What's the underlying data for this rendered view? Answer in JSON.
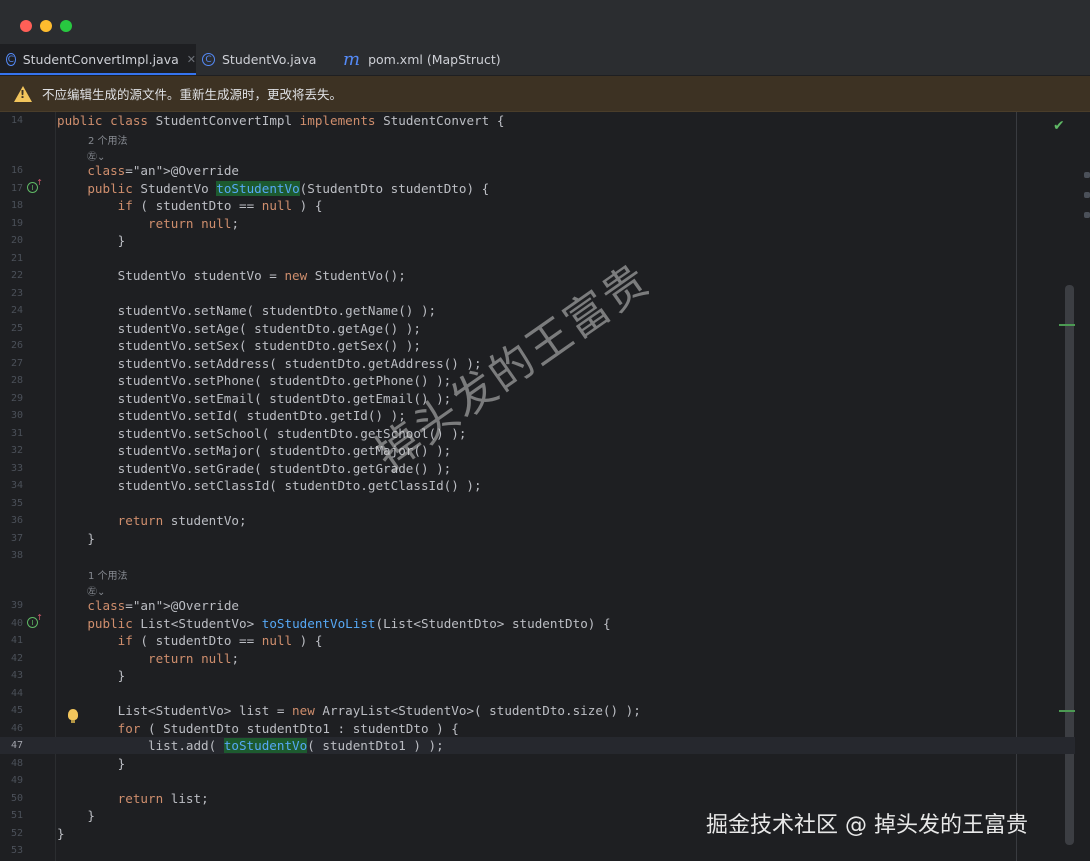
{
  "window": {
    "controls": [
      "close",
      "minimize",
      "maximize"
    ]
  },
  "tabs": [
    {
      "label": "StudentConvertImpl.java",
      "icon": "class-c-icon",
      "active": true,
      "close": "✕"
    },
    {
      "label": "StudentVo.java",
      "icon": "class-c-icon",
      "active": false
    },
    {
      "label": "pom.xml (MapStruct)",
      "icon": "maven-m-icon",
      "active": false
    }
  ],
  "warning": {
    "icon": "warning-triangle-icon",
    "text": "不应编辑生成的源文件。重新生成源时，更改将丢失。"
  },
  "hints": {
    "usages1": "2 个用法",
    "usages2": "1 个用法",
    "author_glyph": "㊧⌄"
  },
  "lines": [
    {
      "n": "14",
      "code": "public class StudentConvertImpl implements StudentConvert {"
    },
    {
      "n": "16",
      "code": "    @Override"
    },
    {
      "n": "17",
      "code": "    public StudentVo toStudentVo(StudentDto studentDto) {"
    },
    {
      "n": "18",
      "code": "        if ( studentDto == null ) {"
    },
    {
      "n": "19",
      "code": "            return null;"
    },
    {
      "n": "20",
      "code": "        }"
    },
    {
      "n": "21",
      "code": ""
    },
    {
      "n": "22",
      "code": "        StudentVo studentVo = new StudentVo();"
    },
    {
      "n": "23",
      "code": ""
    },
    {
      "n": "24",
      "code": "        studentVo.setName( studentDto.getName() );"
    },
    {
      "n": "25",
      "code": "        studentVo.setAge( studentDto.getAge() );"
    },
    {
      "n": "26",
      "code": "        studentVo.setSex( studentDto.getSex() );"
    },
    {
      "n": "27",
      "code": "        studentVo.setAddress( studentDto.getAddress() );"
    },
    {
      "n": "28",
      "code": "        studentVo.setPhone( studentDto.getPhone() );"
    },
    {
      "n": "29",
      "code": "        studentVo.setEmail( studentDto.getEmail() );"
    },
    {
      "n": "30",
      "code": "        studentVo.setId( studentDto.getId() );"
    },
    {
      "n": "31",
      "code": "        studentVo.setSchool( studentDto.getSchool() );"
    },
    {
      "n": "32",
      "code": "        studentVo.setMajor( studentDto.getMajor() );"
    },
    {
      "n": "33",
      "code": "        studentVo.setGrade( studentDto.getGrade() );"
    },
    {
      "n": "34",
      "code": "        studentVo.setClassId( studentDto.getClassId() );"
    },
    {
      "n": "35",
      "code": ""
    },
    {
      "n": "36",
      "code": "        return studentVo;"
    },
    {
      "n": "37",
      "code": "    }"
    },
    {
      "n": "38",
      "code": ""
    },
    {
      "n": "39",
      "code": "    @Override"
    },
    {
      "n": "40",
      "code": "    public List<StudentVo> toStudentVoList(List<StudentDto> studentDto) {"
    },
    {
      "n": "41",
      "code": "        if ( studentDto == null ) {"
    },
    {
      "n": "42",
      "code": "            return null;"
    },
    {
      "n": "43",
      "code": "        }"
    },
    {
      "n": "44",
      "code": ""
    },
    {
      "n": "45",
      "code": "        List<StudentVo> list = new ArrayList<StudentVo>( studentDto.size() );"
    },
    {
      "n": "46",
      "code": "        for ( StudentDto studentDto1 : studentDto ) {"
    },
    {
      "n": "47",
      "code": "            list.add( toStudentVo( studentDto1 ) );"
    },
    {
      "n": "48",
      "code": "        }"
    },
    {
      "n": "49",
      "code": ""
    },
    {
      "n": "50",
      "code": "        return list;"
    },
    {
      "n": "51",
      "code": "    }"
    },
    {
      "n": "52",
      "code": "}"
    },
    {
      "n": "53",
      "code": ""
    }
  ],
  "current_line": "47",
  "gutter_icons": {
    "implements": "implementation-marker-icon",
    "intention": "lightbulb-icon"
  },
  "status": {
    "inspection": "checkmark-icon"
  },
  "watermark": "掉头发的王富贵",
  "footer_watermark": "掘金技术社区 @ 掉头发的王富贵",
  "colors": {
    "keyword": "#cf8e6d",
    "annotation": "#b3ae60",
    "method": "#56a8f5",
    "text": "#bcbec4",
    "warning_bg": "#3d3223"
  }
}
